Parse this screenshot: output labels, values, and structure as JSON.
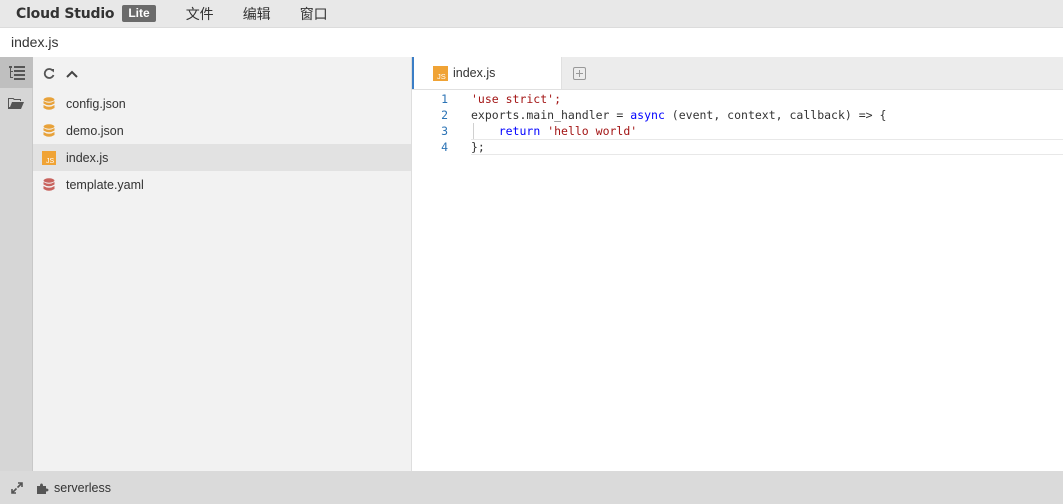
{
  "app": {
    "brand": "Cloud Studio",
    "edition_badge": "Lite"
  },
  "menu": [
    {
      "label": "文件"
    },
    {
      "label": "编辑"
    },
    {
      "label": "窗口"
    }
  ],
  "path": {
    "current_file": "index.js"
  },
  "activity_bar": {
    "items": [
      {
        "icon": "tree-list-icon",
        "active": true
      },
      {
        "icon": "folder-open-icon",
        "active": false
      }
    ]
  },
  "sidebar": {
    "toolbar": {
      "refresh_icon": "refresh-icon",
      "collapse_icon": "chevron-up-icon"
    },
    "files": [
      {
        "name": "config.json",
        "icon": "database-icon",
        "color": "#e8a23a",
        "selected": false
      },
      {
        "name": "demo.json",
        "icon": "database-icon",
        "color": "#e8a23a",
        "selected": false
      },
      {
        "name": "index.js",
        "icon": "js-file-icon",
        "color": "#f0a335",
        "selected": true
      },
      {
        "name": "template.yaml",
        "icon": "database-icon",
        "color": "#c8635e",
        "selected": false
      }
    ]
  },
  "editor": {
    "tabs": [
      {
        "label": "index.js",
        "icon": "js-file-icon",
        "active": true
      }
    ],
    "add_tab_icon": "plus-square-icon",
    "lines": [
      {
        "num": "1",
        "text": "'use strict';"
      },
      {
        "num": "2",
        "text": "exports.main_handler = async (event, context, callback) => {"
      },
      {
        "num": "3",
        "text": "    return 'hello world'"
      },
      {
        "num": "4",
        "text": "};"
      }
    ]
  },
  "statusbar": {
    "expand_icon": "expand-arrows-icon",
    "project_icon": "puzzle-icon",
    "project_name": "serverless"
  },
  "colors": {
    "accent": "#3b7ec6",
    "line_number": "#2b73b5",
    "string": "#a31515",
    "keyword": "#0000ff"
  }
}
